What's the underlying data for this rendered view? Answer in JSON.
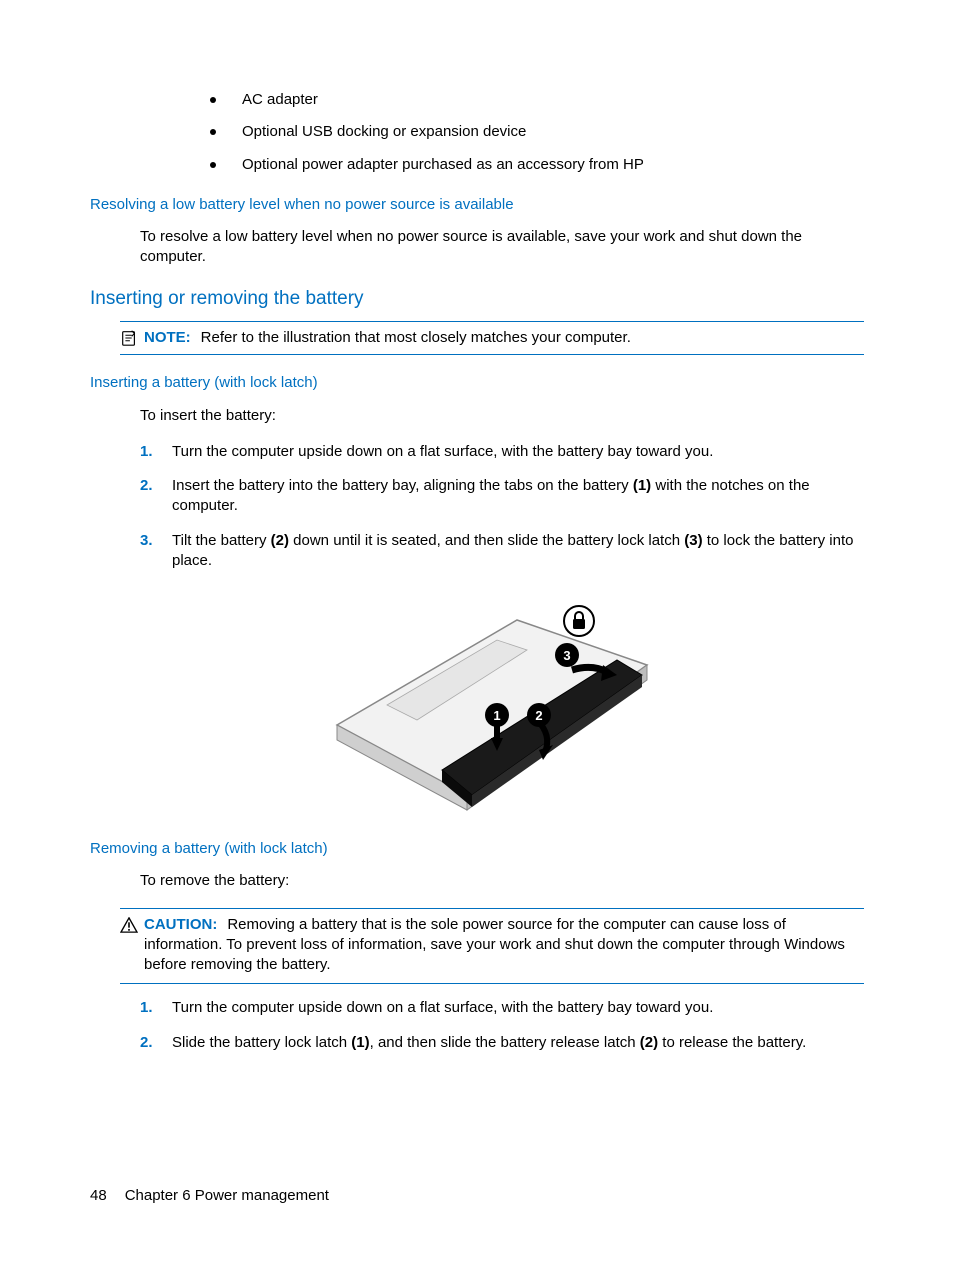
{
  "bullets": {
    "b1": "AC adapter",
    "b2": "Optional USB docking or expansion device",
    "b3": "Optional power adapter purchased as an accessory from HP"
  },
  "section1": {
    "heading": "Resolving a low battery level when no power source is available",
    "body": "To resolve a low battery level when no power source is available, save your work and shut down the computer."
  },
  "section2": {
    "heading": "Inserting or removing the battery",
    "note_label": "NOTE:",
    "note_body": "Refer to the illustration that most closely matches your computer."
  },
  "section3": {
    "heading": "Inserting a battery (with lock latch)",
    "intro": "To insert the battery:",
    "step1": "Turn the computer upside down on a flat surface, with the battery bay toward you.",
    "step2_a": "Insert the battery into the battery bay, aligning the tabs on the battery ",
    "step2_b": "(1)",
    "step2_c": " with the notches on the computer.",
    "step3_a": "Tilt the battery ",
    "step3_b": "(2)",
    "step3_c": " down until it is seated, and then slide the battery lock latch ",
    "step3_d": "(3)",
    "step3_e": " to lock the battery into place."
  },
  "section4": {
    "heading": "Removing a battery (with lock latch)",
    "intro": "To remove the battery:",
    "caution_label": "CAUTION:",
    "caution_body": "Removing a battery that is the sole power source for the computer can cause loss of information. To prevent loss of information, save your work and shut down the computer through Windows before removing the battery.",
    "step1": "Turn the computer upside down on a flat surface, with the battery bay toward you.",
    "step2_a": "Slide the battery lock latch ",
    "step2_b": "(1)",
    "step2_c": ", and then slide the battery release latch ",
    "step2_d": "(2)",
    "step2_e": " to release the battery."
  },
  "ol": {
    "n1": "1.",
    "n2": "2.",
    "n3": "3."
  },
  "footer": {
    "page": "48",
    "chapter": "Chapter 6   Power management"
  }
}
